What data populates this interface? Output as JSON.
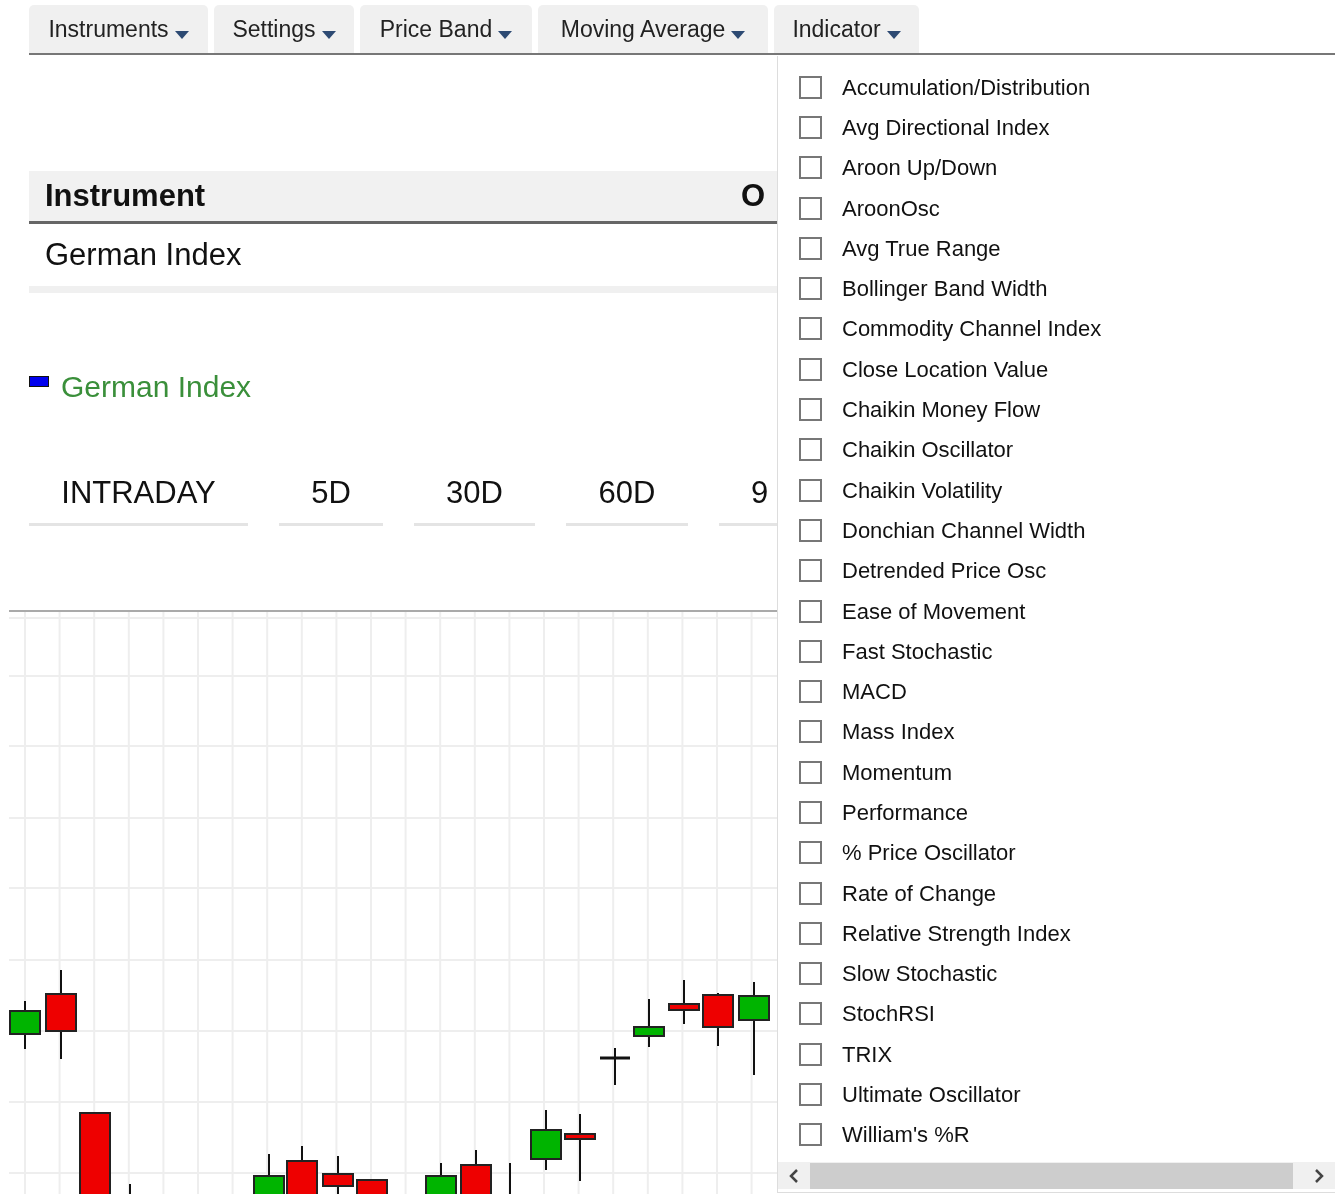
{
  "menu": [
    {
      "label": "Instruments"
    },
    {
      "label": "Settings"
    },
    {
      "label": "Price Band"
    },
    {
      "label": "Moving Average"
    },
    {
      "label": "Indicator"
    }
  ],
  "table": {
    "columns": [
      "Instrument",
      "O"
    ],
    "rows": [
      [
        "German Index"
      ]
    ]
  },
  "legend": {
    "label": "German Index"
  },
  "periods": [
    {
      "label": "INTRADAY"
    },
    {
      "label": "5D"
    },
    {
      "label": "30D"
    },
    {
      "label": "60D"
    },
    {
      "label": "9"
    }
  ],
  "indicators": [
    {
      "label": "Accumulation/Distribution",
      "checked": false
    },
    {
      "label": "Avg Directional Index",
      "checked": false
    },
    {
      "label": "Aroon Up/Down",
      "checked": false
    },
    {
      "label": "AroonOsc",
      "checked": false
    },
    {
      "label": "Avg True Range",
      "checked": false
    },
    {
      "label": "Bollinger Band Width",
      "checked": false
    },
    {
      "label": "Commodity Channel Index",
      "checked": false
    },
    {
      "label": "Close Location Value",
      "checked": false
    },
    {
      "label": "Chaikin Money Flow",
      "checked": false
    },
    {
      "label": "Chaikin Oscillator",
      "checked": false
    },
    {
      "label": "Chaikin Volatility",
      "checked": false
    },
    {
      "label": "Donchian Channel Width",
      "checked": false
    },
    {
      "label": "Detrended Price Osc",
      "checked": false
    },
    {
      "label": "Ease of Movement",
      "checked": false
    },
    {
      "label": "Fast Stochastic",
      "checked": false
    },
    {
      "label": "MACD",
      "checked": false
    },
    {
      "label": "Mass Index",
      "checked": false
    },
    {
      "label": "Momentum",
      "checked": false
    },
    {
      "label": "Performance",
      "checked": false
    },
    {
      "label": "% Price Oscillator",
      "checked": false
    },
    {
      "label": "Rate of Change",
      "checked": false
    },
    {
      "label": "Relative Strength Index",
      "checked": false
    },
    {
      "label": "Slow Stochastic",
      "checked": false
    },
    {
      "label": "StochRSI",
      "checked": false
    },
    {
      "label": "TRIX",
      "checked": false
    },
    {
      "label": "Ultimate Oscillator",
      "checked": false
    },
    {
      "label": "William's %R",
      "checked": false
    }
  ]
}
